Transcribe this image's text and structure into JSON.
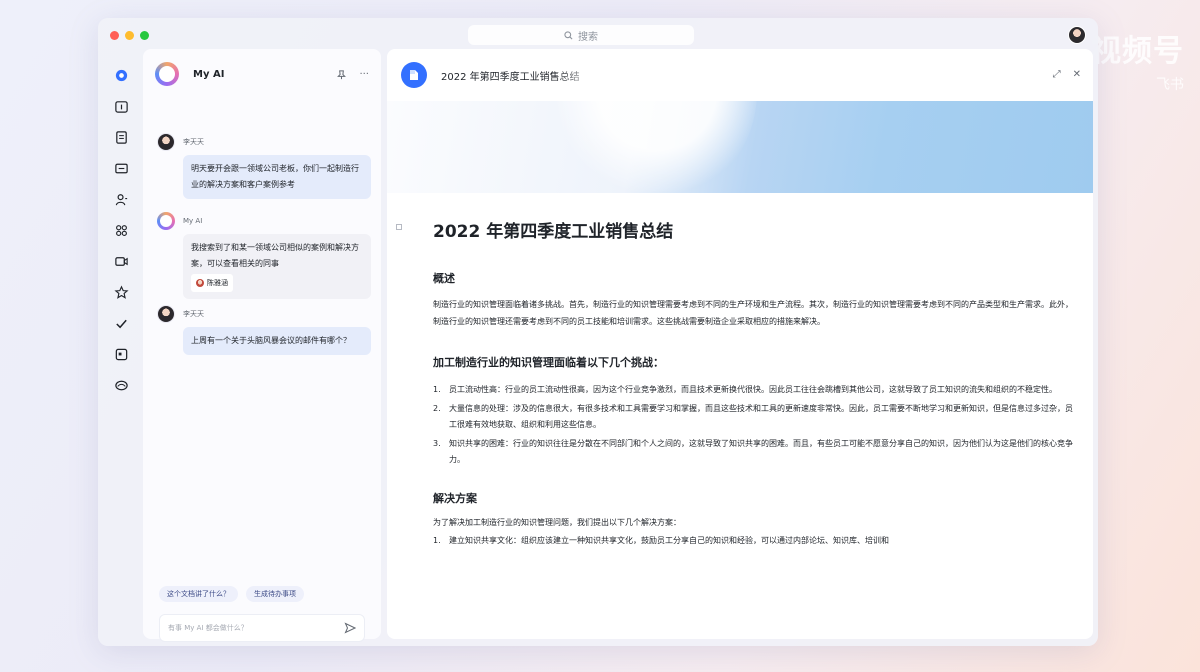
{
  "watermark": {
    "main": "视频号",
    "sub": "飞书"
  },
  "app": {
    "search_placeholder": "搜索",
    "traffic_lights": [
      "#ff5f57",
      "#febc2e",
      "#28c840"
    ],
    "accent": "#3370ff"
  },
  "nav_icons": [
    "message-icon",
    "calendar-icon",
    "docs-icon",
    "mail-icon",
    "contacts-icon",
    "apps-icon",
    "video-icon",
    "favorites-icon",
    "tasks-icon",
    "calendar2-icon",
    "wiki-icon"
  ],
  "chat": {
    "title": "My AI",
    "messages": [
      {
        "role": "user",
        "sender": "李天天",
        "text": "明天要开会跟一领域公司老板，你们一起制造行业的解决方案和客户案例参考"
      },
      {
        "role": "ai",
        "sender": "My AI",
        "text": "我搜索到了和某一领域公司相似的案例和解决方案，可以查看相关的同事",
        "ref": "陈雅涵"
      },
      {
        "role": "user",
        "sender": "李天天",
        "text": "上周有一个关于头脑风暴会议的邮件有哪个？"
      }
    ],
    "suggestions": [
      "这个文档讲了什么？",
      "生成待办事项"
    ],
    "input_placeholder": "有事 My AI 都会做什么？"
  },
  "document": {
    "header_title": "2022 年第四季度工业销售总结",
    "title": "2022 年第四季度工业销售总结",
    "section1_heading": "概述",
    "section1_para": "制造行业的知识管理面临着诸多挑战。首先，制造行业的知识管理需要考虑到不同的生产环境和生产流程。其次，制造行业的知识管理需要考虑到不同的产品类型和生产需求。此外，制造行业的知识管理还需要考虑到不同的员工技能和培训需求。这些挑战需要制造企业采取相应的措施来解决。",
    "section2_heading": "加工制造行业的知识管理面临着以下几个挑战：",
    "challenges": [
      "员工流动性高：行业的员工流动性很高，因为这个行业竞争激烈，而且技术更新换代很快。因此员工往往会跳槽到其他公司，这就导致了员工知识的流失和组织的不稳定性。",
      "大量信息的处理：涉及的信息很大，有很多技术和工具需要学习和掌握，而且这些技术和工具的更新速度非常快。因此，员工需要不断地学习和更新知识，但是信息过多过杂，员工很难有效地获取、组织和利用这些信息。",
      "知识共享的困难：行业的知识往往是分散在不同部门和个人之间的，这就导致了知识共享的困难。而且，有些员工可能不愿意分享自己的知识，因为他们认为这是他们的核心竞争力。"
    ],
    "section3_heading": "解决方案",
    "section3_intro": "为了解决加工制造行业的知识管理问题，我们提出以下几个解决方案：",
    "solutions": [
      "建立知识共享文化：组织应该建立一种知识共享文化，鼓励员工分享自己的知识和经验，可以通过内部论坛、知识库、培训和"
    ]
  }
}
